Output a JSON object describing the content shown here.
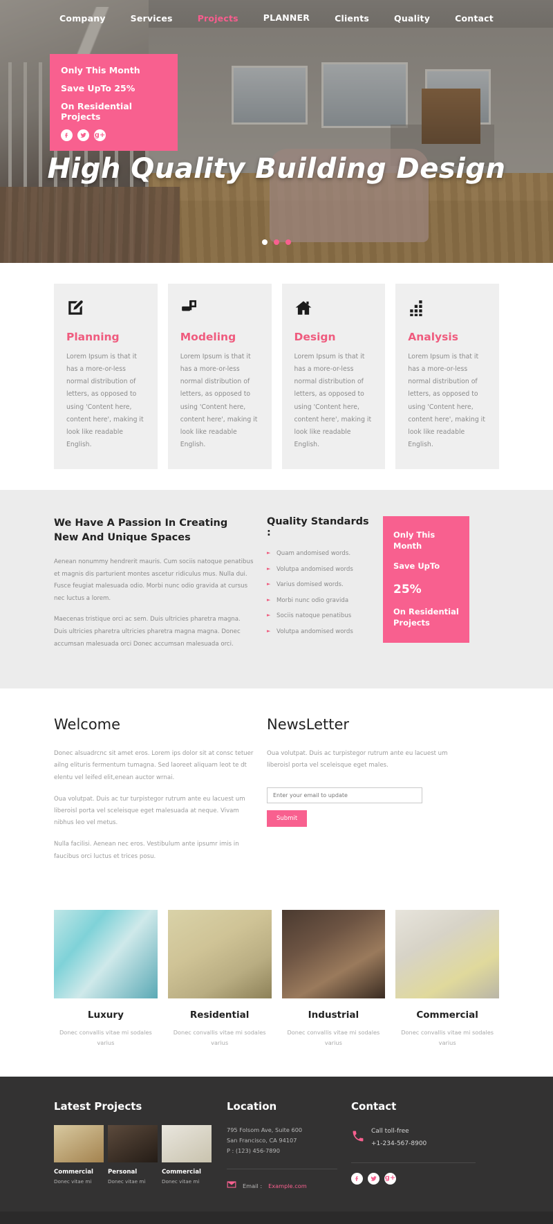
{
  "nav": {
    "brand": "PLANNER",
    "left": [
      {
        "label": "Company",
        "active": false
      },
      {
        "label": "Services",
        "active": false
      },
      {
        "label": "Projects",
        "active": true
      }
    ],
    "right": [
      {
        "label": "Clients",
        "active": false
      },
      {
        "label": "Quality",
        "active": false
      },
      {
        "label": "Contact",
        "active": false
      }
    ]
  },
  "hero": {
    "title": "High Quality Building Design",
    "promo": {
      "line1": "Only This Month",
      "line2": "Save UpTo 25%",
      "line3": "On Residential Projects",
      "socials": [
        "facebook-icon",
        "twitter-icon",
        "google-plus-icon"
      ]
    },
    "slider_dots": 3,
    "active_dot": 1
  },
  "services": {
    "body": "Lorem Ipsum is that it has a more-or-less normal distribution of letters, as opposed to using 'Content here, content here', making it look like readable English.",
    "cards": [
      {
        "title": "Planning",
        "icon": "edit-square-icon"
      },
      {
        "title": "Modeling",
        "icon": "monitor-icon"
      },
      {
        "title": "Design",
        "icon": "home-icon"
      },
      {
        "title": "Analysis",
        "icon": "bar-grid-icon"
      }
    ]
  },
  "passion": {
    "heading": "We Have A Passion In Creating New And Unique Spaces",
    "paragraph1": "Aenean nonummy hendrerit mauris. Cum sociis natoque penatibus et magnis dis parturient montes ascetur ridiculus mus. Nulla dui. Fusce feugiat malesuada odio. Morbi nunc odio gravida at cursus nec luctus a lorem.",
    "paragraph2": "Maecenas tristique orci ac sem. Duis ultricies pharetra magna. Duis ultricies pharetra ultricies pharetra magna magna. Donec accumsan malesuada orci Donec accumsan malesuada orci.",
    "standards_title": "Quality Standards :",
    "standards": [
      "Quam andomised words.",
      "Volutpa andomised words",
      "Varius domised words.",
      "Morbi nunc odio gravida",
      "Sociis natoque penatibus",
      "Volutpa andomised words"
    ],
    "offer": {
      "line1": "Only This Month",
      "line2": "Save UpTo",
      "line3": "25%",
      "line4": "On Residential Projects"
    }
  },
  "welcome": {
    "title": "Welcome",
    "paragraph1": "Donec alsuadrcnc sit amet eros. Lorem ips dolor sit at consc tetuer ailng elituris fermentum tumagna. Sed laoreet aliquam leot te dt elentu vel leifed elit,enean auctor wrnai.",
    "paragraph2": "Oua volutpat. Duis ac tur turpistegor rutrum ante eu lacuest um liberoisl porta vel sceleisque eget malesuada at neque. Vivam nibhus leo vel metus.",
    "paragraph3": "Nulla facilisi. Aenean nec eros. Vestibulum ante ipsumr imis in faucibus orci luctus et trices posu."
  },
  "newsletter": {
    "title": "NewsLetter",
    "paragraph": "Oua volutpat. Duis ac turpistegor rutrum ante eu lacuest um liberoisl porta vel sceleisque eget males.",
    "placeholder": "Enter your email to update",
    "input_value": "",
    "submit_label": "Submit"
  },
  "portfolio": {
    "caption": "Donec convallis vitae mi sodales varius",
    "items": [
      {
        "title": "Luxury",
        "thumb": "luxury-thumb"
      },
      {
        "title": "Residential",
        "thumb": "residential-thumb"
      },
      {
        "title": "Industrial",
        "thumb": "industrial-thumb"
      },
      {
        "title": "Commercial",
        "thumb": "commercial-thumb"
      }
    ]
  },
  "footer": {
    "latest_projects": {
      "title": "Latest Projects",
      "items": [
        {
          "title": "Commercial",
          "caption": "Donec vitae mi"
        },
        {
          "title": "Personal",
          "caption": "Donec vitae mi"
        },
        {
          "title": "Commercial",
          "caption": "Donec vitae mi"
        }
      ]
    },
    "location": {
      "title": "Location",
      "address1": "795 Folsom Ave, Suite 600",
      "address2": "San Francisco, CA 94107",
      "phone": "P : (123) 456-7890",
      "email_label": "Email :",
      "email_link": "Example.com"
    },
    "contact": {
      "title": "Contact",
      "call_label": "Call toll-free",
      "phone": "+1-234-567-8900",
      "socials": [
        "facebook-icon",
        "twitter-icon",
        "google-plus-icon"
      ]
    }
  },
  "colors": {
    "accent_pink": "#f8608f",
    "card_bg": "#efefef",
    "section_bg": "#ececec",
    "footer_bg": "#333232"
  }
}
